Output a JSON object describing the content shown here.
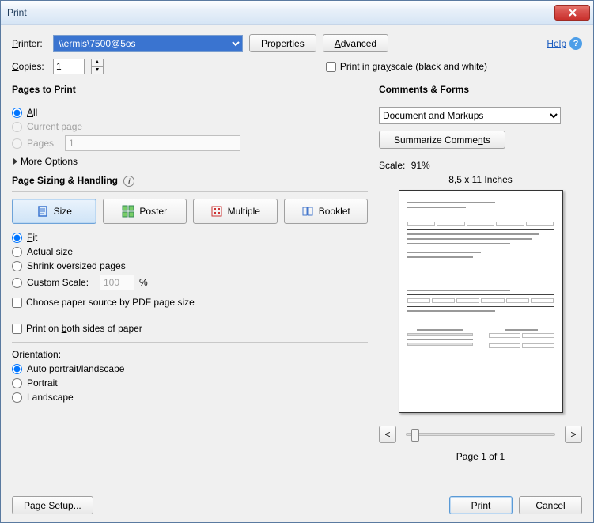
{
  "window": {
    "title": "Print"
  },
  "top": {
    "printer_label": "Printer:",
    "printer_value": "\\\\ermis\\7500@5os",
    "properties_btn": "Properties",
    "advanced_btn": "Advanced",
    "help_label": "Help",
    "copies_label": "Copies:",
    "copies_value": "1",
    "grayscale_label": "Print in grayscale (black and white)",
    "grayscale_hotkey": "y"
  },
  "pages": {
    "title": "Pages to Print",
    "all": "All",
    "current": "Current page",
    "pages": "Pages",
    "pages_value": "1",
    "more": "More Options",
    "selected": "all"
  },
  "sizing": {
    "title": "Page Sizing & Handling",
    "modes": {
      "size": "Size",
      "poster": "Poster",
      "multiple": "Multiple",
      "booklet": "Booklet"
    },
    "active_mode": "size",
    "fit": "Fit",
    "actual": "Actual size",
    "shrink": "Shrink oversized pages",
    "custom": "Custom Scale:",
    "custom_value": "100",
    "pct": "%",
    "choose_source": "Choose paper source by PDF page size",
    "both_sides": "Print on both sides of paper",
    "selected": "fit"
  },
  "orientation": {
    "label": "Orientation:",
    "auto": "Auto portrait/landscape",
    "portrait": "Portrait",
    "landscape": "Landscape",
    "selected": "auto"
  },
  "comments": {
    "title": "Comments & Forms",
    "value": "Document and Markups",
    "summarize": "Summarize Comments"
  },
  "preview": {
    "scale_label": "Scale:",
    "scale_value": "91%",
    "dimensions": "8,5 x 11 Inches",
    "page_of": "Page 1 of 1",
    "prev": "<",
    "next": ">"
  },
  "footer": {
    "page_setup": "Page Setup...",
    "print": "Print",
    "cancel": "Cancel"
  }
}
